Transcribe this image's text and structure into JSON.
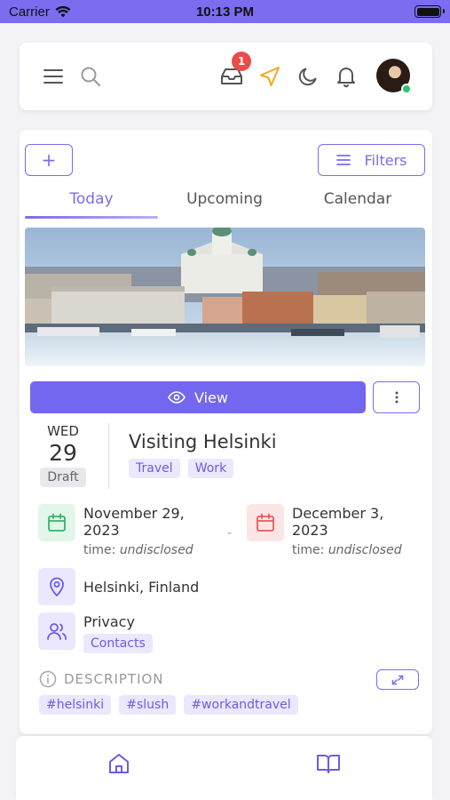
{
  "status_bar": {
    "carrier": "Carrier",
    "time": "10:13 PM"
  },
  "header": {
    "icons": [
      "menu-icon",
      "search-icon",
      "inbox-icon",
      "navigation-icon",
      "moon-icon",
      "bell-icon"
    ],
    "inbox_badge": "1",
    "accent_color": "#7b6cf0",
    "navigation_color": "#f5a623"
  },
  "toolbar": {
    "add_label": "+",
    "filters_label": "Filters"
  },
  "tabs": [
    {
      "label": "Today",
      "active": true
    },
    {
      "label": "Upcoming",
      "active": false
    },
    {
      "label": "Calendar",
      "active": false
    }
  ],
  "event": {
    "view_label": "View",
    "day_of_week": "WED",
    "day": "29",
    "status": "Draft",
    "title": "Visiting Helsinki",
    "tags": [
      "Travel",
      "Work"
    ],
    "start": {
      "date_line1": "November 29,",
      "date_line2": "2023",
      "time_prefix": "time:",
      "time_value": "undisclosed"
    },
    "separator": "-",
    "end": {
      "date_line1": "December 3,",
      "date_line2": "2023",
      "time_prefix": "time:",
      "time_value": "undisclosed"
    },
    "location": "Helsinki, Finland",
    "privacy_label": "Privacy",
    "privacy_value": "Contacts",
    "description_label": "DESCRIPTION",
    "hashtags": [
      "#helsinki",
      "#slush",
      "#workandtravel"
    ]
  },
  "bottom_nav": [
    "home-icon",
    "book-icon"
  ]
}
